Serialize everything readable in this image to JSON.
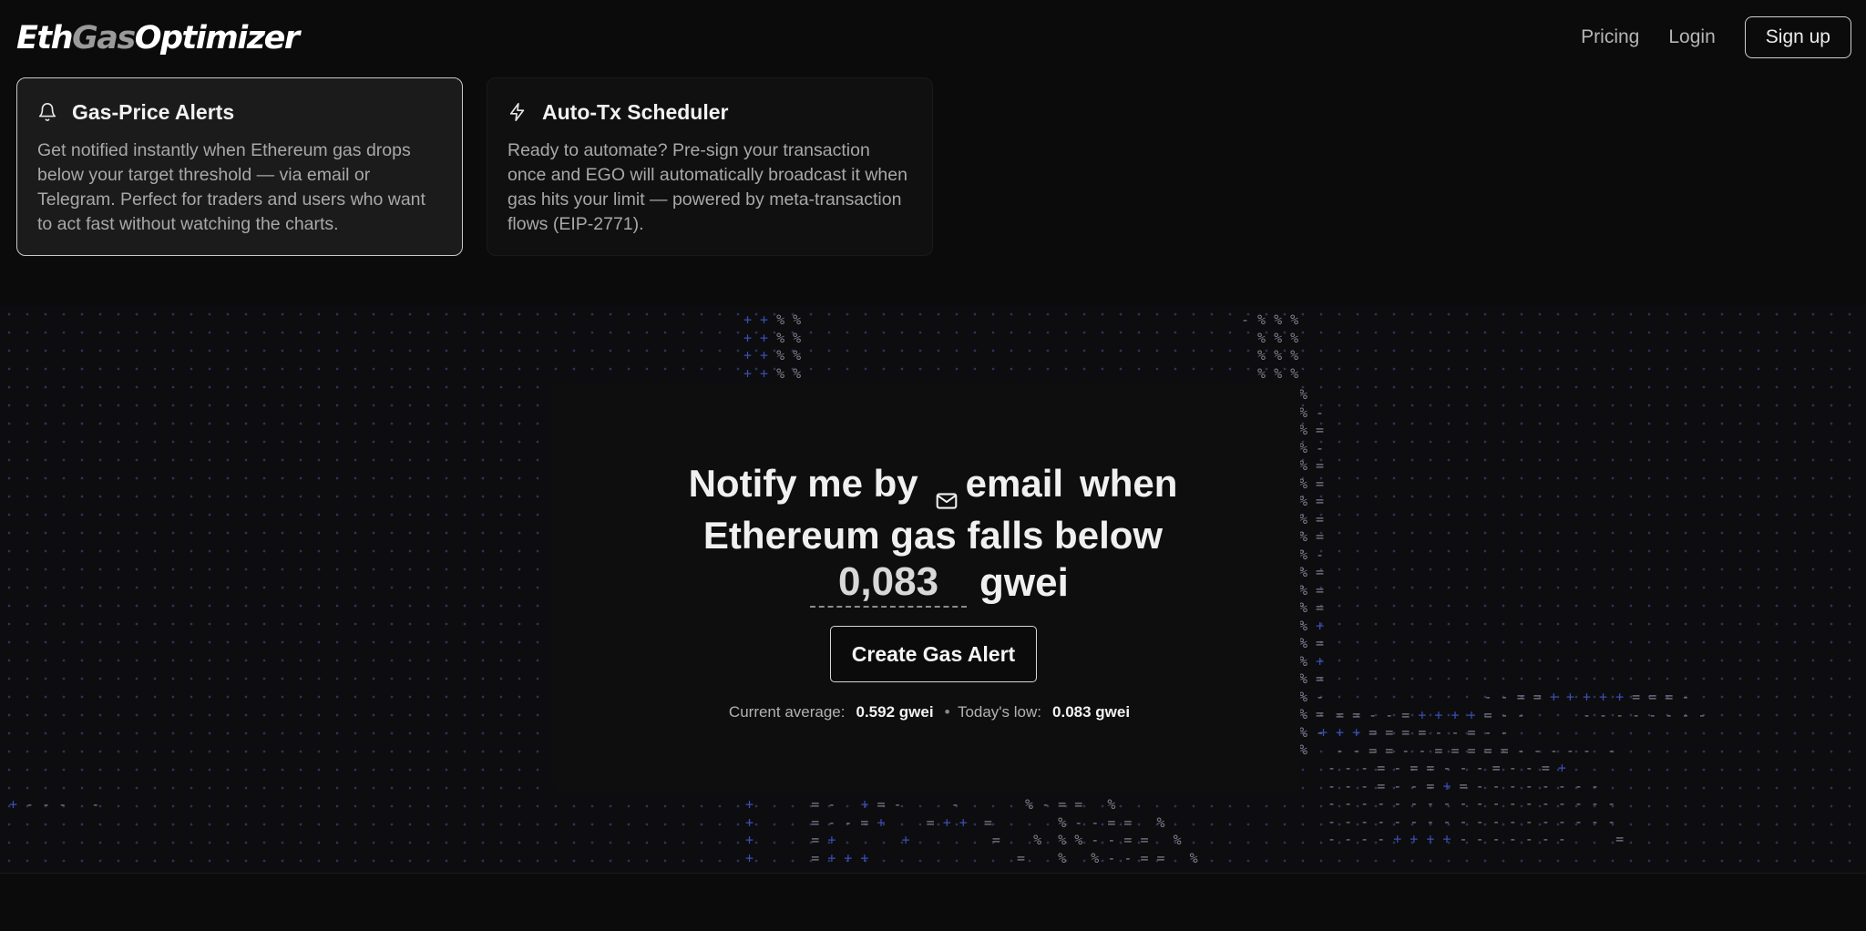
{
  "brand": {
    "part1": "Eth",
    "part2": "Gas",
    "part3": "Optimizer"
  },
  "nav": {
    "pricing": "Pricing",
    "login": "Login",
    "signup": "Sign up"
  },
  "features": [
    {
      "icon": "bell-icon",
      "title": "Gas-Price Alerts",
      "description": "Get notified instantly when Ethereum gas drops below your target threshold — via email or Telegram. Perfect for traders and users who want to act fast without watching the charts."
    },
    {
      "icon": "lightning-icon",
      "title": "Auto-Tx Scheduler",
      "description": "Ready to automate? Pre-sign your transaction once and EGO will automatically broadcast it when gas hits your limit — powered by meta-transaction flows (EIP-2771)."
    }
  ],
  "hero": {
    "prefix": "Notify me by",
    "channel_icon": "mail-icon",
    "channel": "email",
    "when": "when",
    "line2": "Ethereum gas falls below",
    "threshold_value": "0,083",
    "unit": "gwei"
  },
  "cta": {
    "label": "Create Gas Alert"
  },
  "stats": {
    "current_label": "Current average:",
    "current_value": "0.592 gwei",
    "separator": "•",
    "low_label": "Today's low:",
    "low_value": "0.083 gwei"
  },
  "colors": {
    "background": "#0b0b0b",
    "dot_grid": "#3a4fb8",
    "text": "#f0f0f0"
  }
}
